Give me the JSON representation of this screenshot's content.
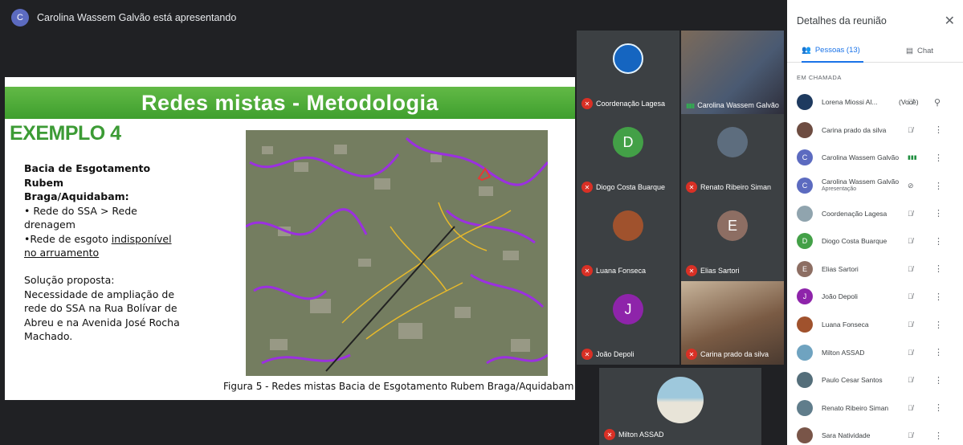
{
  "presenter": {
    "initial": "C",
    "text": "Carolina Wassem Galvão está apresentando"
  },
  "slide": {
    "title": "Redes mistas - Metodologia",
    "example": "EXEMPLO 4",
    "heading_line1": "Bacia de Esgotamento Rubem",
    "heading_line2": "Braga/Aquidabam:",
    "bullet1": "• Rede do SSA > Rede drenagem",
    "bullet2_prefix": "•Rede de esgoto ",
    "bullet2_underlined": "indisponível no arruamento",
    "solution_label": "Solução proposta:",
    "solution_text": "Necessidade de ampliação de rede do SSA na Rua Bolívar de Abreu e na Avenida José Rocha Machado.",
    "caption": "Figura 5 - Redes mistas Bacia de Esgotamento Rubem Braga/Aquidabam"
  },
  "tiles": [
    {
      "name": "Coordenação Lagesa",
      "initial": "",
      "color": "#3c4043",
      "muted": true
    },
    {
      "name": "Carolina Wassem Galvão",
      "initial": "",
      "color": "#6b5a4a",
      "muted": false
    },
    {
      "name": "Diogo Costa Buarque",
      "initial": "D",
      "color": "#43a047",
      "muted": true
    },
    {
      "name": "Renato Ribeiro Siman",
      "initial": "",
      "color": "#5d6d7e",
      "muted": true
    },
    {
      "name": "Luana Fonseca",
      "initial": "",
      "color": "#a0522d",
      "muted": true
    },
    {
      "name": "Elias Sartori",
      "initial": "E",
      "color": "#8d6e63",
      "muted": true
    },
    {
      "name": "João Depoli",
      "initial": "J",
      "color": "#8e24aa",
      "muted": true
    },
    {
      "name": "Carina prado da silva",
      "initial": "",
      "color": "#8a6b4f",
      "muted": true
    },
    {
      "name": "Milton ASSAD",
      "initial": "",
      "color": "#87b5c9",
      "muted": true
    }
  ],
  "panel": {
    "title": "Detalhes da reunião",
    "close": "✕",
    "tab_people": "Pessoas (13)",
    "tab_chat": "Chat",
    "section": "EM CHAMADA",
    "participants": [
      {
        "name": "Lorena Miossi Al...",
        "you": "(Você)",
        "sub": "",
        "initial": "",
        "color": "#1e3a5f"
      },
      {
        "name": "Carina prado da silva",
        "you": "",
        "sub": "",
        "initial": "",
        "color": "#6d4c41"
      },
      {
        "name": "Carolina Wassem Galvão",
        "you": "",
        "sub": "",
        "initial": "C",
        "color": "#5c6bc0"
      },
      {
        "name": "Carolina Wassem Galvão",
        "you": "",
        "sub": "Apresentação",
        "initial": "C",
        "color": "#5c6bc0"
      },
      {
        "name": "Coordenação Lagesa",
        "you": "",
        "sub": "",
        "initial": "",
        "color": "#90a4ae"
      },
      {
        "name": "Diogo Costa Buarque",
        "you": "",
        "sub": "",
        "initial": "D",
        "color": "#43a047"
      },
      {
        "name": "Elias Sartori",
        "you": "",
        "sub": "",
        "initial": "E",
        "color": "#8d6e63"
      },
      {
        "name": "João Depoli",
        "you": "",
        "sub": "",
        "initial": "J",
        "color": "#8e24aa"
      },
      {
        "name": "Luana Fonseca",
        "you": "",
        "sub": "",
        "initial": "",
        "color": "#a0522d"
      },
      {
        "name": "Milton ASSAD",
        "you": "",
        "sub": "",
        "initial": "",
        "color": "#6fa3c0"
      },
      {
        "name": "Paulo Cesar Santos",
        "you": "",
        "sub": "",
        "initial": "",
        "color": "#546e7a"
      },
      {
        "name": "Renato Ribeiro Siman",
        "you": "",
        "sub": "",
        "initial": "",
        "color": "#607d8b"
      },
      {
        "name": "Sara Natividade",
        "you": "",
        "sub": "",
        "initial": "",
        "color": "#795548"
      }
    ]
  }
}
